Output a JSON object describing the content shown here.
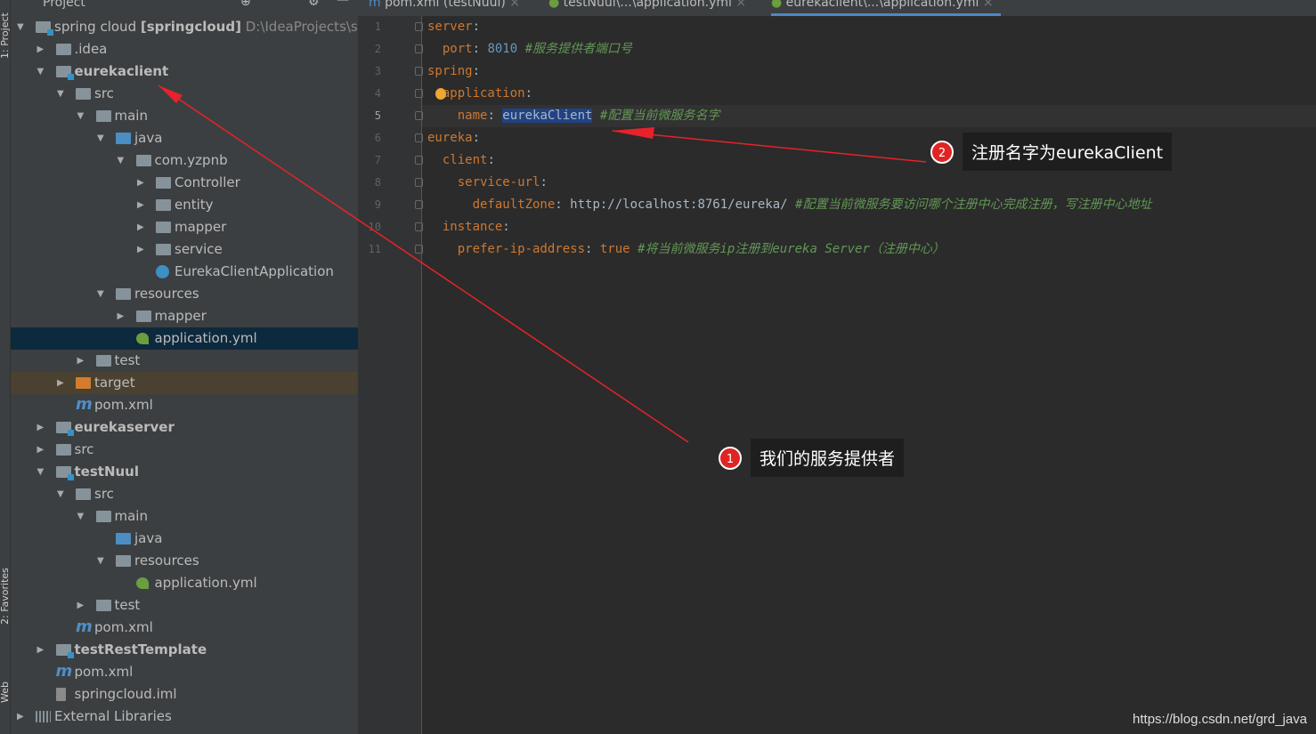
{
  "side_strip": {
    "project_label": "1: Project",
    "favorites_label": "2: Favorites",
    "web_label": "Web"
  },
  "project_panel": {
    "title": "Project",
    "rows": [
      {
        "level": 0,
        "arrow": "down",
        "icon": "module",
        "text": "spring cloud ",
        "bold_text": "[springcloud]",
        "path": " D:\\IdeaProjects\\spr"
      },
      {
        "level": 1,
        "arrow": "right",
        "icon": "folder",
        "text": ".idea"
      },
      {
        "level": 1,
        "arrow": "down",
        "icon": "module",
        "bold_text": "eurekaclient"
      },
      {
        "level": 2,
        "arrow": "down",
        "icon": "folder",
        "text": "src"
      },
      {
        "level": 3,
        "arrow": "down",
        "icon": "folder",
        "text": "main"
      },
      {
        "level": 4,
        "arrow": "down",
        "icon": "source-folder",
        "text": "java"
      },
      {
        "level": 5,
        "arrow": "down",
        "icon": "package",
        "text": "com.yzpnb"
      },
      {
        "level": 6,
        "arrow": "right",
        "icon": "package",
        "text": "Controller"
      },
      {
        "level": 6,
        "arrow": "right",
        "icon": "package",
        "text": "entity"
      },
      {
        "level": 6,
        "arrow": "right",
        "icon": "package",
        "text": "mapper"
      },
      {
        "level": 6,
        "arrow": "right",
        "icon": "package",
        "text": "service"
      },
      {
        "level": 6,
        "arrow": "",
        "icon": "spring-class",
        "text": "EurekaClientApplication"
      },
      {
        "level": 4,
        "arrow": "down",
        "icon": "resources-folder",
        "text": "resources"
      },
      {
        "level": 5,
        "arrow": "right",
        "icon": "folder",
        "text": "mapper"
      },
      {
        "level": 5,
        "arrow": "",
        "icon": "yml",
        "text": "application.yml",
        "selected": true
      },
      {
        "level": 3,
        "arrow": "right",
        "icon": "folder",
        "text": "test"
      },
      {
        "level": 2,
        "arrow": "right",
        "icon": "excluded-folder",
        "text": "target",
        "highlight": true
      },
      {
        "level": 2,
        "arrow": "",
        "icon": "maven",
        "text": "pom.xml"
      },
      {
        "level": 1,
        "arrow": "right",
        "icon": "module",
        "bold_text": "eurekaserver"
      },
      {
        "level": 1,
        "arrow": "right",
        "icon": "folder",
        "text": "src"
      },
      {
        "level": 1,
        "arrow": "down",
        "icon": "module",
        "bold_text": "testNuul"
      },
      {
        "level": 2,
        "arrow": "down",
        "icon": "folder",
        "text": "src"
      },
      {
        "level": 3,
        "arrow": "down",
        "icon": "folder",
        "text": "main"
      },
      {
        "level": 4,
        "arrow": "",
        "icon": "source-folder",
        "text": "java"
      },
      {
        "level": 4,
        "arrow": "down",
        "icon": "resources-folder",
        "text": "resources"
      },
      {
        "level": 5,
        "arrow": "",
        "icon": "yml",
        "text": "application.yml"
      },
      {
        "level": 3,
        "arrow": "right",
        "icon": "folder",
        "text": "test"
      },
      {
        "level": 2,
        "arrow": "",
        "icon": "maven",
        "text": "pom.xml"
      },
      {
        "level": 1,
        "arrow": "right",
        "icon": "module",
        "bold_text": "testRestTemplate"
      },
      {
        "level": 1,
        "arrow": "",
        "icon": "maven",
        "text": "pom.xml"
      },
      {
        "level": 1,
        "arrow": "",
        "icon": "iml",
        "text": "springcloud.iml"
      },
      {
        "level": 0,
        "arrow": "right",
        "icon": "libraries",
        "text": "External Libraries"
      }
    ]
  },
  "tabs": [
    {
      "label": "pom.xml (testNuul)",
      "icon": "maven",
      "active": false
    },
    {
      "label": "testNuul\\...\\application.yml",
      "icon": "yml",
      "active": false
    },
    {
      "label": "eurekaclient\\...\\application.yml",
      "icon": "yml",
      "active": true
    }
  ],
  "editor": {
    "current_line": 5,
    "lines": [
      [
        {
          "t": "server",
          "c": "k"
        },
        {
          "t": ":"
        }
      ],
      [
        {
          "t": "  "
        },
        {
          "t": "port",
          "c": "k"
        },
        {
          "t": ": "
        },
        {
          "t": "8010",
          "c": "n"
        },
        {
          "t": " "
        },
        {
          "t": "#服务提供者端口号",
          "c": "c"
        }
      ],
      [
        {
          "t": "spring",
          "c": "k"
        },
        {
          "t": ":"
        }
      ],
      [
        {
          "t": "  "
        },
        {
          "t": "application",
          "c": "k"
        },
        {
          "t": ":"
        }
      ],
      [
        {
          "t": "    "
        },
        {
          "t": "name",
          "c": "k"
        },
        {
          "t": ": "
        },
        {
          "t": "eurekaClient",
          "c": "hl"
        },
        {
          "t": " "
        },
        {
          "t": "#配置当前微服务名字",
          "c": "c"
        }
      ],
      [
        {
          "t": "eureka",
          "c": "k"
        },
        {
          "t": ":"
        }
      ],
      [
        {
          "t": "  "
        },
        {
          "t": "client",
          "c": "k"
        },
        {
          "t": ":"
        }
      ],
      [
        {
          "t": "    "
        },
        {
          "t": "service-url",
          "c": "k"
        },
        {
          "t": ":"
        }
      ],
      [
        {
          "t": "      "
        },
        {
          "t": "defaultZone",
          "c": "k"
        },
        {
          "t": ": http://localhost:8761/eureka/ "
        },
        {
          "t": "#配置当前微服务要访问哪个注册中心完成注册，写注册中心地址",
          "c": "c"
        }
      ],
      [
        {
          "t": "  "
        },
        {
          "t": "instance",
          "c": "k"
        },
        {
          "t": ":"
        }
      ],
      [
        {
          "t": "    "
        },
        {
          "t": "prefer-ip-address",
          "c": "k"
        },
        {
          "t": ": "
        },
        {
          "t": "true",
          "c": "k"
        },
        {
          "t": " "
        },
        {
          "t": "#将当前微服务ip注册到eureka Server（注册中心）",
          "c": "c"
        }
      ]
    ]
  },
  "annotations": [
    {
      "number": "1",
      "text": "我们的服务提供者"
    },
    {
      "number": "2",
      "text": "注册名字为eurekaClient"
    }
  ],
  "watermark": "https://blog.csdn.net/grd_java",
  "colors": {
    "arrow": "#e8222a",
    "selection": "#214283",
    "accent": "#4a88c7"
  }
}
